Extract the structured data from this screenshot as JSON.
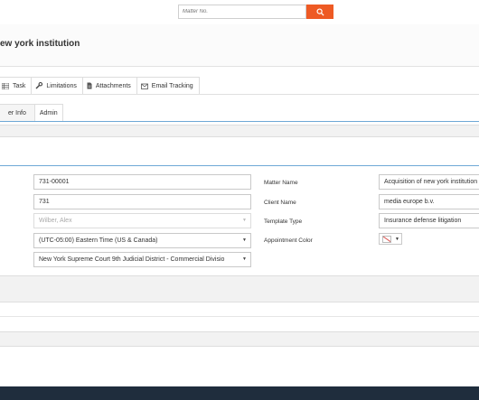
{
  "search": {
    "placeholder": "Matter No."
  },
  "page_title": "ew york institution",
  "top_tabs": [
    {
      "label": "Task",
      "icon": "list-icon"
    },
    {
      "label": "Limitations",
      "icon": "wrench-icon"
    },
    {
      "label": "Attachments",
      "icon": "file-icon"
    },
    {
      "label": "Email Tracking",
      "icon": "envelope-icon"
    }
  ],
  "sub_tabs": [
    {
      "label": "er Info"
    },
    {
      "label": "Admin"
    }
  ],
  "left_fields": [
    {
      "value": "731-00001"
    },
    {
      "value": "731"
    },
    {
      "value": "Wilber, Alex"
    },
    {
      "value": "(UTC-05:00) Eastern Time (US & Canada)"
    },
    {
      "value": "New York Supreme Court 9th Judicial District - Commercial Divisio"
    }
  ],
  "right_labels": {
    "matter_name": "Matter Name",
    "client_name": "Client Name",
    "template_type": "Template Type",
    "appointment_color": "Appointment Color"
  },
  "right_fields": {
    "matter_name": "Acquisition of new york institution",
    "client_name": "media europe b.v.",
    "template_type": "Insurance defense litigation"
  },
  "colors": {
    "accent": "#ee5a24",
    "blue_rule": "#6fa8d6",
    "footer": "#1f2d3d"
  }
}
